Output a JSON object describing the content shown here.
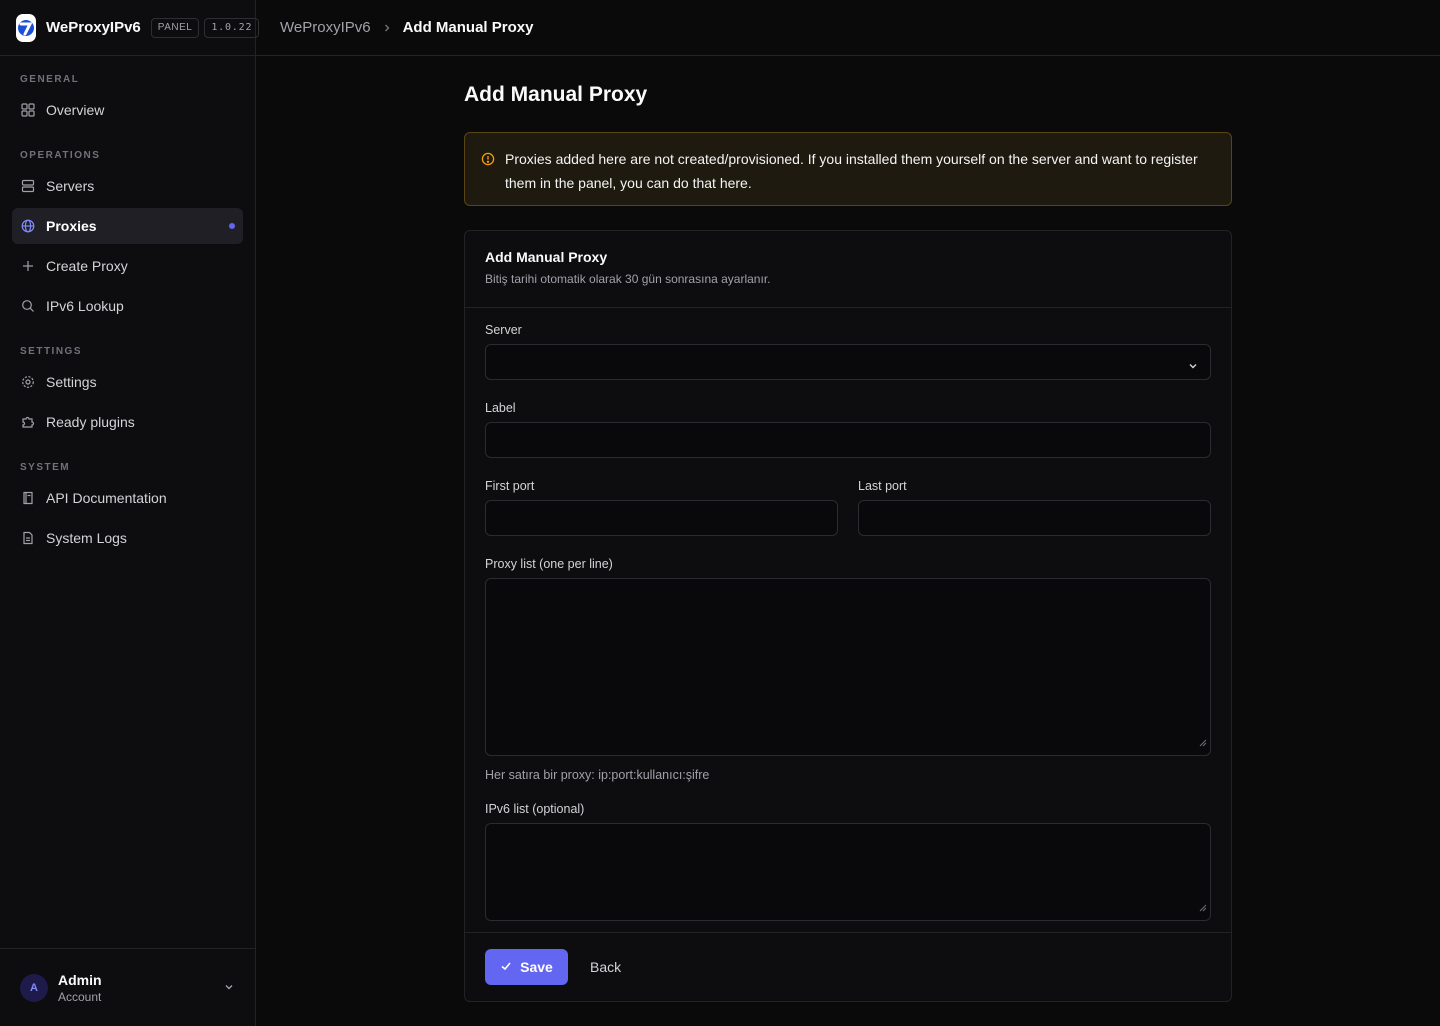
{
  "brand": {
    "name": "WeProxyIPv6",
    "badge": "PANEL",
    "version": "1.0.22"
  },
  "sidebar": {
    "sections": [
      {
        "label": "GENERAL",
        "items": [
          {
            "label": "Overview",
            "icon": "grid-icon"
          }
        ]
      },
      {
        "label": "OPERATIONS",
        "items": [
          {
            "label": "Servers",
            "icon": "server-icon"
          },
          {
            "label": "Proxies",
            "icon": "globe-icon",
            "active": true
          },
          {
            "label": "Create Proxy",
            "icon": "plus-icon"
          },
          {
            "label": "IPv6 Lookup",
            "icon": "search-icon"
          }
        ]
      },
      {
        "label": "SETTINGS",
        "items": [
          {
            "label": "Settings",
            "icon": "gear-icon"
          },
          {
            "label": "Ready plugins",
            "icon": "puzzle-icon"
          }
        ]
      },
      {
        "label": "SYSTEM",
        "items": [
          {
            "label": "API Documentation",
            "icon": "book-icon"
          },
          {
            "label": "System Logs",
            "icon": "file-icon"
          }
        ]
      }
    ]
  },
  "user": {
    "initial": "A",
    "name": "Admin",
    "role": "Account"
  },
  "breadcrumb": {
    "root": "WeProxyIPv6",
    "current": "Add Manual Proxy"
  },
  "page": {
    "title": "Add Manual Proxy"
  },
  "alert": {
    "text": "Proxies added here are not created/provisioned. If you installed them yourself on the server and want to register them in the panel, you can do that here."
  },
  "form": {
    "title": "Add Manual Proxy",
    "subtitle": "Bitiş tarihi otomatik olarak 30 gün sonrasına ayarlanır.",
    "server_label": "Server",
    "server_value": "",
    "label_label": "Label",
    "label_value": "",
    "first_port_label": "First port",
    "first_port_value": "",
    "last_port_label": "Last port",
    "last_port_value": "",
    "proxy_list_label": "Proxy list (one per line)",
    "proxy_list_value": "",
    "proxy_list_hint": "Her satıra bir proxy: ip:port:kullanıcı:şifre",
    "ipv6_list_label": "IPv6 list (optional)",
    "ipv6_list_value": "",
    "save_label": "Save",
    "back_label": "Back"
  },
  "colors": {
    "accent": "#6366f1",
    "warning_border": "#5a4514",
    "warning_icon": "#f59e0b"
  }
}
